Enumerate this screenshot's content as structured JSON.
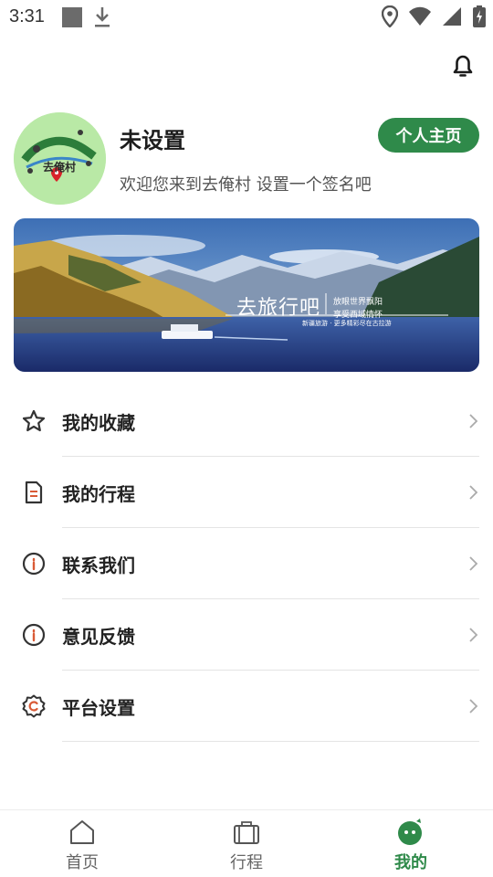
{
  "status_bar": {
    "time": "3:31"
  },
  "profile": {
    "username": "未设置",
    "welcome": "欢迎您来到去俺村 设置一个签名吧",
    "home_button": "个人主页",
    "avatar_logo_text": "去俺村"
  },
  "banner": {
    "title": "去旅行吧",
    "line1": "放眼世界飘阳",
    "line2": "享受西域情怀",
    "sub": "新疆旅游 · 更多精彩尽在古拉游"
  },
  "menu": {
    "items": [
      {
        "label": "我的收藏",
        "icon": "star-icon"
      },
      {
        "label": "我的行程",
        "icon": "document-icon"
      },
      {
        "label": "联系我们",
        "icon": "info-icon"
      },
      {
        "label": "意见反馈",
        "icon": "info-icon"
      },
      {
        "label": "平台设置",
        "icon": "settings-icon"
      }
    ]
  },
  "bottom_nav": {
    "items": [
      {
        "label": "首页",
        "icon": "home-icon"
      },
      {
        "label": "行程",
        "icon": "briefcase-icon"
      },
      {
        "label": "我的",
        "icon": "profile-icon",
        "active": true
      }
    ]
  },
  "colors": {
    "accent": "#2f8a4a",
    "text": "#222222",
    "muted": "#555555",
    "divider": "#e4e4e4"
  }
}
